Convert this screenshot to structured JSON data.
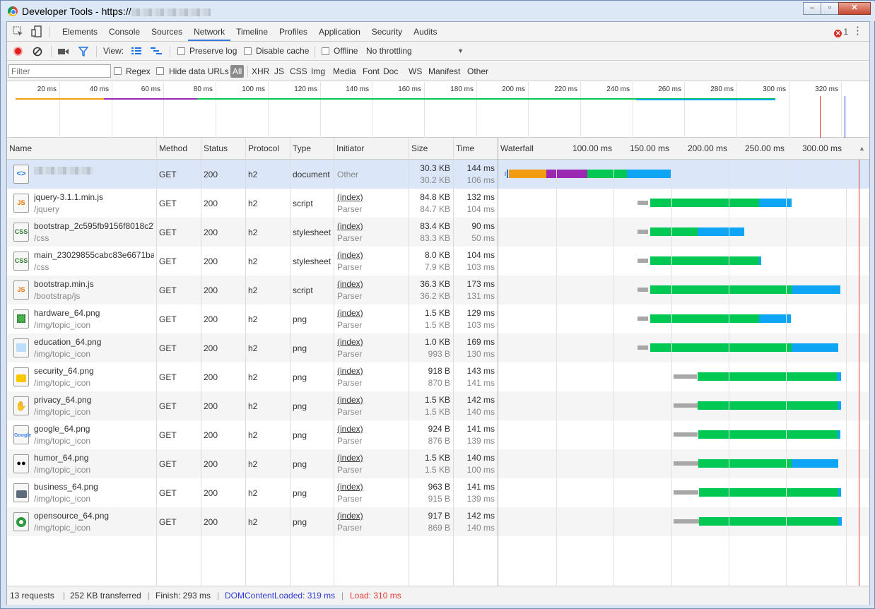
{
  "window": {
    "title": "Developer Tools - https://",
    "minimize": "–",
    "restore": "▫",
    "close": "✕"
  },
  "tabs": [
    "Elements",
    "Console",
    "Sources",
    "Network",
    "Timeline",
    "Profiles",
    "Application",
    "Security",
    "Audits"
  ],
  "active_tab": "Network",
  "errors": "1",
  "toolbar": {
    "view_label": "View:",
    "preserve_log": "Preserve log",
    "disable_cache": "Disable cache",
    "offline": "Offline",
    "throttling": "No throttling"
  },
  "filter": {
    "placeholder": "Filter",
    "regex": "Regex",
    "hide_data_urls": "Hide data URLs",
    "types": [
      "All",
      "XHR",
      "JS",
      "CSS",
      "Img",
      "Media",
      "Font",
      "Doc",
      "WS",
      "Manifest",
      "Other"
    ]
  },
  "overview_ticks": [
    "20 ms",
    "40 ms",
    "60 ms",
    "80 ms",
    "100 ms",
    "120 ms",
    "140 ms",
    "160 ms",
    "180 ms",
    "200 ms",
    "220 ms",
    "240 ms",
    "260 ms",
    "280 ms",
    "300 ms",
    "320 ms"
  ],
  "columns": {
    "name": "Name",
    "method": "Method",
    "status": "Status",
    "protocol": "Protocol",
    "type": "Type",
    "initiator": "Initiator",
    "size": "Size",
    "time": "Time",
    "waterfall": "Waterfall"
  },
  "waterfall_ticks": [
    "100.00 ms",
    "150.00 ms",
    "200.00 ms",
    "250.00 ms",
    "300.00 ms"
  ],
  "colors": {
    "waiting": "#a7a7a7",
    "receiving_green": "#00c853",
    "download_blue": "#0ea5f5",
    "purple": "#9c27b0",
    "orange": "#f39c12",
    "dom_content": "#2f3ad4",
    "load": "#e53935"
  },
  "requests": [
    {
      "name": "",
      "path": "",
      "method": "GET",
      "status": "200",
      "protocol": "h2",
      "type": "document",
      "initiator": "Other",
      "initiator_sub": "",
      "size": "30.3 KB",
      "size_sub": "30.2 KB",
      "time": "144 ms",
      "time_sub": "106 ms",
      "icon": "html-icon"
    },
    {
      "name": "jquery-3.1.1.min.js",
      "path": "/jquery",
      "method": "GET",
      "status": "200",
      "protocol": "h2",
      "type": "script",
      "initiator": "(index)",
      "initiator_sub": "Parser",
      "size": "84.8 KB",
      "size_sub": "84.7 KB",
      "time": "132 ms",
      "time_sub": "104 ms",
      "icon": "js-icon"
    },
    {
      "name": "bootstrap_2c595fb9156f8018c27…",
      "path": "/css",
      "method": "GET",
      "status": "200",
      "protocol": "h2",
      "type": "stylesheet",
      "initiator": "(index)",
      "initiator_sub": "Parser",
      "size": "83.4 KB",
      "size_sub": "83.3 KB",
      "time": "90 ms",
      "time_sub": "50 ms",
      "icon": "css-icon"
    },
    {
      "name": "main_23029855cabc83e6671ba1…",
      "path": "/css",
      "method": "GET",
      "status": "200",
      "protocol": "h2",
      "type": "stylesheet",
      "initiator": "(index)",
      "initiator_sub": "Parser",
      "size": "8.0 KB",
      "size_sub": "7.9 KB",
      "time": "104 ms",
      "time_sub": "103 ms",
      "icon": "css-icon"
    },
    {
      "name": "bootstrap.min.js",
      "path": "/bootstrap/js",
      "method": "GET",
      "status": "200",
      "protocol": "h2",
      "type": "script",
      "initiator": "(index)",
      "initiator_sub": "Parser",
      "size": "36.3 KB",
      "size_sub": "36.2 KB",
      "time": "173 ms",
      "time_sub": "131 ms",
      "icon": "js-icon"
    },
    {
      "name": "hardware_64.png",
      "path": "/img/topic_icon",
      "method": "GET",
      "status": "200",
      "protocol": "h2",
      "type": "png",
      "initiator": "(index)",
      "initiator_sub": "Parser",
      "size": "1.5 KB",
      "size_sub": "1.5 KB",
      "time": "129 ms",
      "time_sub": "103 ms",
      "icon": "chip-icon"
    },
    {
      "name": "education_64.png",
      "path": "/img/topic_icon",
      "method": "GET",
      "status": "200",
      "protocol": "h2",
      "type": "png",
      "initiator": "(index)",
      "initiator_sub": "Parser",
      "size": "1.0 KB",
      "size_sub": "993 B",
      "time": "169 ms",
      "time_sub": "130 ms",
      "icon": "education-icon"
    },
    {
      "name": "security_64.png",
      "path": "/img/topic_icon",
      "method": "GET",
      "status": "200",
      "protocol": "h2",
      "type": "png",
      "initiator": "(index)",
      "initiator_sub": "Parser",
      "size": "918 B",
      "size_sub": "870 B",
      "time": "143 ms",
      "time_sub": "141 ms",
      "icon": "lock-icon"
    },
    {
      "name": "privacy_64.png",
      "path": "/img/topic_icon",
      "method": "GET",
      "status": "200",
      "protocol": "h2",
      "type": "png",
      "initiator": "(index)",
      "initiator_sub": "Parser",
      "size": "1.5 KB",
      "size_sub": "1.5 KB",
      "time": "142 ms",
      "time_sub": "140 ms",
      "icon": "privacy-icon"
    },
    {
      "name": "google_64.png",
      "path": "/img/topic_icon",
      "method": "GET",
      "status": "200",
      "protocol": "h2",
      "type": "png",
      "initiator": "(index)",
      "initiator_sub": "Parser",
      "size": "924 B",
      "size_sub": "876 B",
      "time": "141 ms",
      "time_sub": "139 ms",
      "icon": "google-icon"
    },
    {
      "name": "humor_64.png",
      "path": "/img/topic_icon",
      "method": "GET",
      "status": "200",
      "protocol": "h2",
      "type": "png",
      "initiator": "(index)",
      "initiator_sub": "Parser",
      "size": "1.5 KB",
      "size_sub": "1.5 KB",
      "time": "140 ms",
      "time_sub": "100 ms",
      "icon": "humor-icon"
    },
    {
      "name": "business_64.png",
      "path": "/img/topic_icon",
      "method": "GET",
      "status": "200",
      "protocol": "h2",
      "type": "png",
      "initiator": "(index)",
      "initiator_sub": "Parser",
      "size": "963 B",
      "size_sub": "915 B",
      "time": "141 ms",
      "time_sub": "139 ms",
      "icon": "briefcase-icon"
    },
    {
      "name": "opensource_64.png",
      "path": "/img/topic_icon",
      "method": "GET",
      "status": "200",
      "protocol": "h2",
      "type": "png",
      "initiator": "(index)",
      "initiator_sub": "Parser",
      "size": "917 B",
      "size_sub": "869 B",
      "time": "142 ms",
      "time_sub": "140 ms",
      "icon": "opensource-icon"
    }
  ],
  "status": {
    "requests": "13 requests",
    "transferred": "252 KB transferred",
    "finish": "Finish: 293 ms",
    "dom": "DOMContentLoaded: 319 ms",
    "load": "Load: 310 ms"
  }
}
